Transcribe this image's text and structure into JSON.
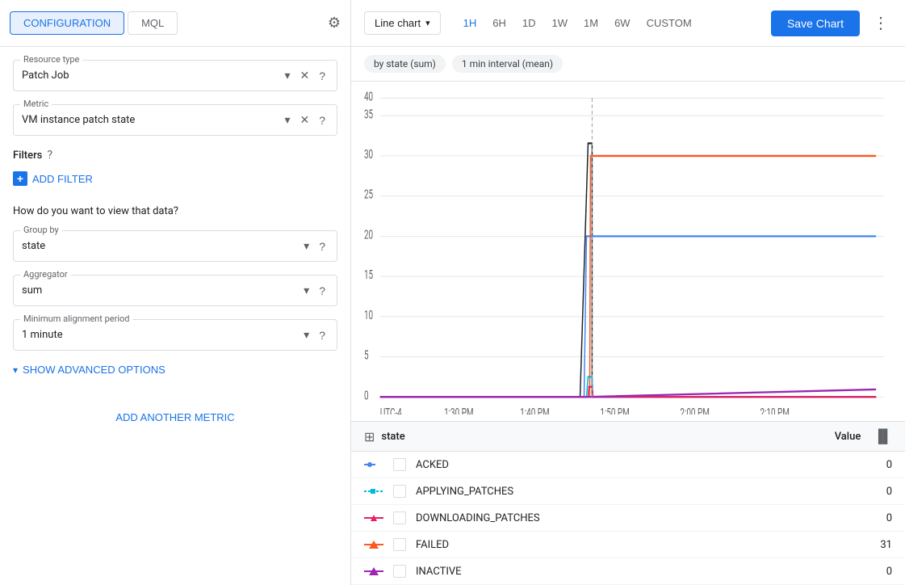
{
  "tabs": {
    "configuration": "CONFIGURATION",
    "mql": "MQL",
    "active": "configuration"
  },
  "header": {
    "gear_icon": "⚙",
    "chart_type": "Line chart",
    "chart_dropdown_icon": "▾",
    "time_ranges": [
      "1H",
      "6H",
      "1D",
      "1W",
      "1M",
      "6W",
      "CUSTOM"
    ],
    "active_time": "1H",
    "save_label": "Save Chart",
    "more_icon": "⋮"
  },
  "left_panel": {
    "resource_type": {
      "label": "Resource type",
      "value": "Patch Job",
      "clear_icon": "✕",
      "help_icon": "?"
    },
    "metric": {
      "label": "Metric",
      "value": "VM instance patch state",
      "clear_icon": "✕",
      "help_icon": "?"
    },
    "filters": {
      "label": "Filters",
      "help_icon": "?",
      "add_label": "ADD FILTER"
    },
    "view_section": {
      "title": "How do you want to view that data?",
      "group_by": {
        "label": "Group by",
        "value": "state",
        "help_icon": "?"
      },
      "aggregator": {
        "label": "Aggregator",
        "value": "sum",
        "help_icon": "?"
      },
      "min_alignment": {
        "label": "Minimum alignment period",
        "value": "1 minute",
        "help_icon": "?"
      }
    },
    "advanced_link": "SHOW ADVANCED OPTIONS",
    "add_metric": "ADD ANOTHER METRIC"
  },
  "chart": {
    "filter_tags": [
      "by state (sum)",
      "1 min interval (mean)"
    ],
    "y_axis": [
      0,
      5,
      10,
      15,
      20,
      25,
      30,
      35,
      40
    ],
    "x_axis": [
      "UTC-4",
      "1:30 PM",
      "1:40 PM",
      "1:50 PM",
      "2:00 PM",
      "2:10 PM"
    ]
  },
  "legend": {
    "header": {
      "icon": "⊞",
      "state_label": "state",
      "value_label": "Value",
      "bars_icon": "▐▌"
    },
    "rows": [
      {
        "name": "ACKED",
        "value": "0",
        "color": "#4285f4",
        "dash": "line"
      },
      {
        "name": "APPLYING_PATCHES",
        "value": "0",
        "color": "#00bcd4",
        "dash": "dashed"
      },
      {
        "name": "DOWNLOADING_PATCHES",
        "value": "0",
        "color": "#e91e63",
        "dash": "diamond"
      },
      {
        "name": "FAILED",
        "value": "31",
        "color": "#ff5722",
        "dash": "arrow"
      },
      {
        "name": "INACTIVE",
        "value": "0",
        "color": "#9c27b0",
        "dash": "arrow"
      }
    ]
  }
}
